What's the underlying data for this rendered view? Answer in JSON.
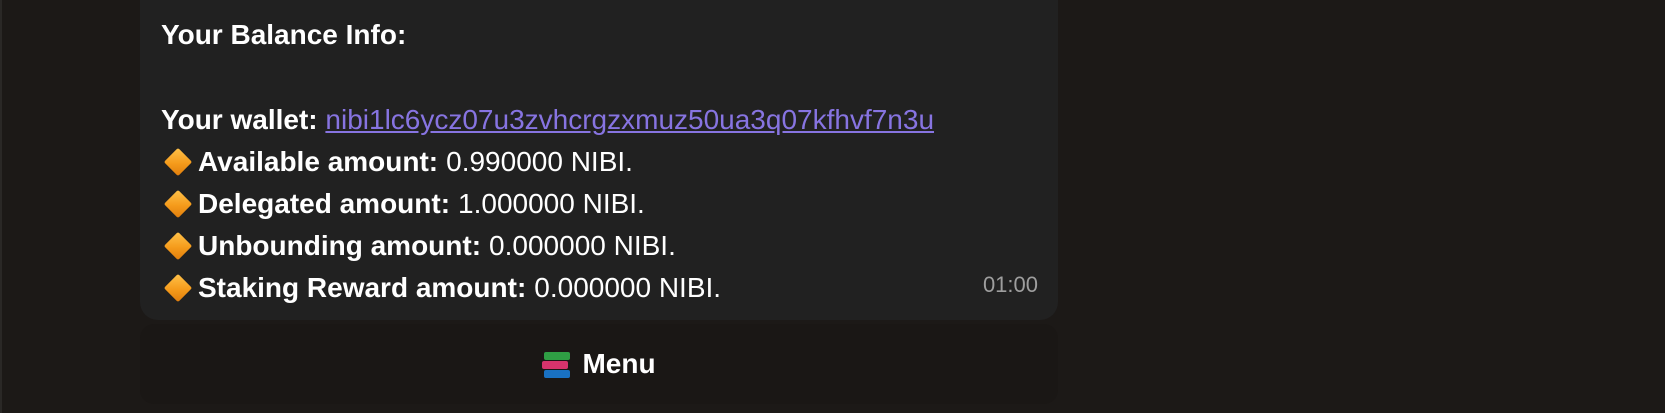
{
  "message": {
    "heading": "Your Balance Info:",
    "wallet_label": "Your wallet:",
    "wallet_address": "nibi1lc6ycz07u3zvhcrgzxmuz50ua3q07kfhvf7n3u",
    "rows": [
      {
        "icon": "orange-diamond-icon",
        "label": "Available amount:",
        "value": "0.990000 NIBI."
      },
      {
        "icon": "orange-diamond-icon",
        "label": "Delegated amount:",
        "value": "1.000000 NIBI."
      },
      {
        "icon": "orange-diamond-icon",
        "label": "Unbounding amount:",
        "value": "0.000000 NIBI."
      },
      {
        "icon": "orange-diamond-icon",
        "label": "Staking Reward amount:",
        "value": "0.000000 NIBI."
      }
    ],
    "timestamp": "01:00"
  },
  "keyboard": {
    "menu_icon": "books-icon",
    "menu_label": "Menu"
  },
  "colors": {
    "background": "#1c1917",
    "bubble": "#212121",
    "link": "#8774e1",
    "timestamp": "#9e9e9e",
    "diamond": "#f59b1b"
  }
}
